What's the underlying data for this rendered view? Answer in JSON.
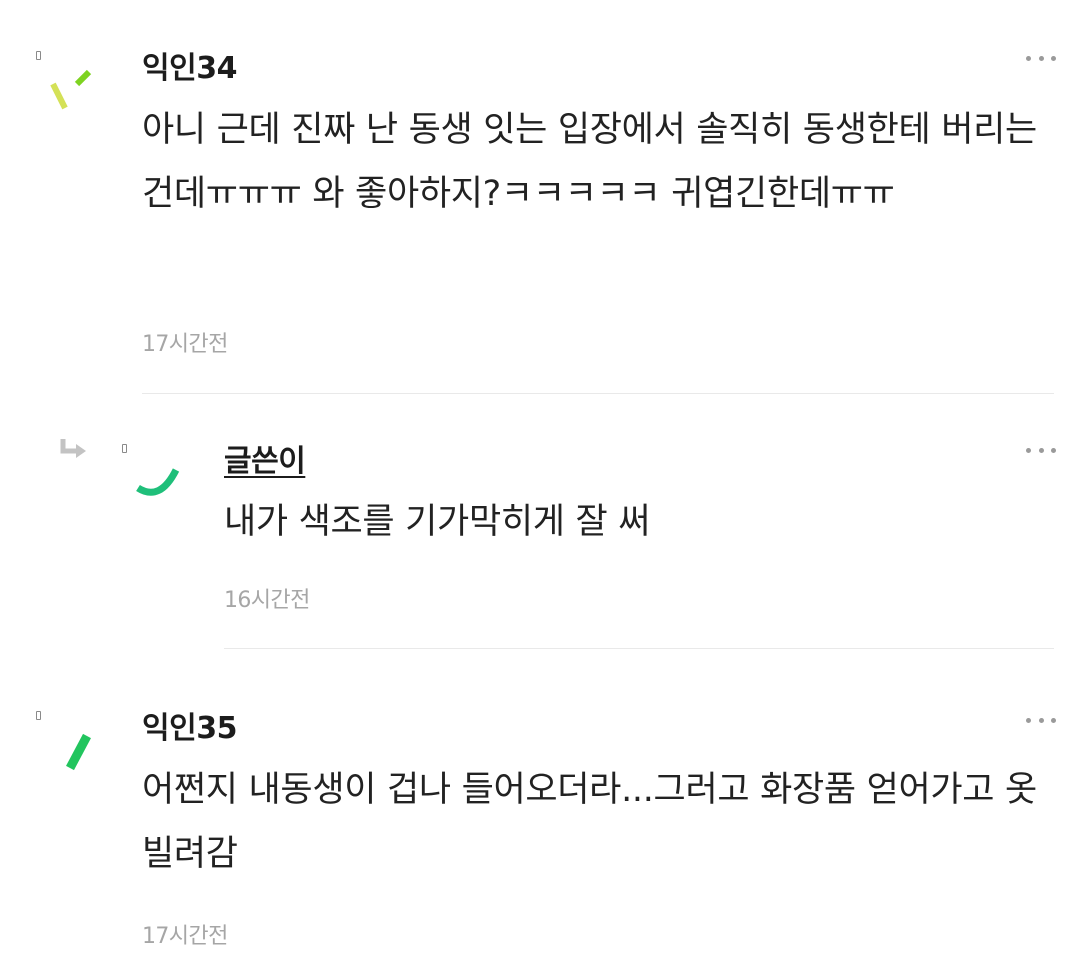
{
  "comments": [
    {
      "author": "익인34",
      "body": "아니 근데 진짜 난 동생 잇는 입장에서 솔직히 동생한테 버리는 건데ㅠㅠㅠ 와 좋아하지?ㅋㅋㅋㅋㅋ 귀엽긴한데ㅠㅠ",
      "time": "17시간전",
      "avatar_colors": [
        "#d4e157",
        "#7ed321"
      ]
    },
    {
      "author": "글쓴이",
      "body": "내가 색조를 기가막히게 잘 써",
      "time": "16시간전",
      "is_reply": true,
      "avatar_colors": [
        "#1fbf7a"
      ]
    },
    {
      "author": "익인35",
      "body": "어쩐지 내동생이 겁나 들어오더라...그러고 화장품 얻어가고 옷빌려감",
      "time": "17시간전",
      "avatar_colors": [
        "#22c55e"
      ]
    }
  ],
  "icons": {
    "more": "more-dots-icon",
    "reply": "reply-arrow-icon",
    "marker": "comment-marker-icon"
  },
  "colors": {
    "text": "#222222",
    "timestamp": "#a6a6a6",
    "divider": "#e9e9e9"
  }
}
